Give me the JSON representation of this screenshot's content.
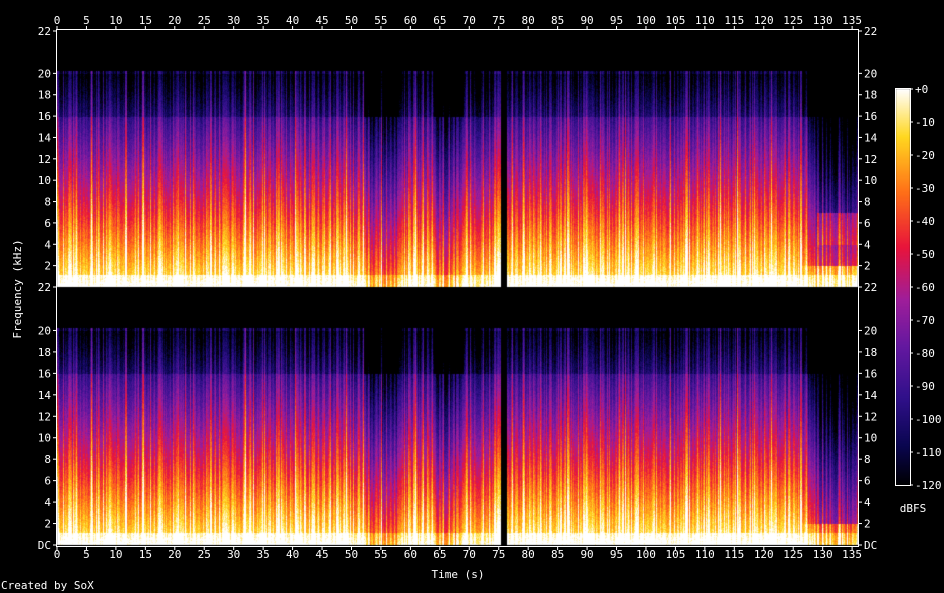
{
  "chart_data": {
    "type": "heatmap",
    "title": "",
    "xlabel": "Time (s)",
    "ylabel": "Frequency (kHz)",
    "xlim": [
      0,
      136
    ],
    "ylim": [
      0,
      22
    ],
    "x_ticks": [
      "0",
      "5",
      "10",
      "15",
      "20",
      "25",
      "30",
      "35",
      "40",
      "45",
      "50",
      "55",
      "60",
      "65",
      "70",
      "75",
      "80",
      "85",
      "90",
      "95",
      "100",
      "105",
      "110",
      "115",
      "120",
      "125",
      "130",
      "135"
    ],
    "y_ticks": [
      "DC",
      "2",
      "4",
      "6",
      "8",
      "10",
      "12",
      "14",
      "16",
      "18",
      "20",
      "22"
    ],
    "channels": 2,
    "colorbar": {
      "label": "dBFS",
      "ticks": [
        "+0",
        "-10",
        "-20",
        "-30",
        "-40",
        "-50",
        "-60",
        "-70",
        "-80",
        "-90",
        "-100",
        "-110",
        "-120"
      ],
      "range": [
        -120,
        0
      ]
    },
    "features": {
      "gap_time_s": 75.8,
      "lowpass_cutoff_khz": 20,
      "quiet_sections_s": [
        [
          52,
          58
        ],
        [
          64,
          69
        ]
      ],
      "fade_start_s": 126
    },
    "colors": {
      "black": "#000000",
      "navy": "#0a0650",
      "indigo": "#30108a",
      "purple": "#6418a0",
      "magenta": "#a01e9a",
      "red": "#e8143c",
      "orange": "#ff7018",
      "yellow": "#ffd820",
      "white": "#ffffff"
    }
  },
  "footer": {
    "credit": "Created by SoX"
  }
}
